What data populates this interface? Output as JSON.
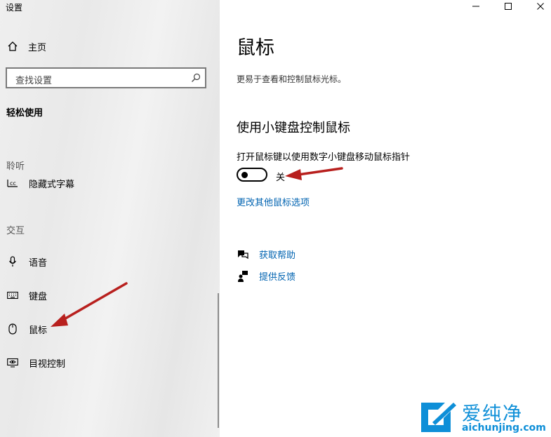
{
  "window": {
    "app_title": "设置",
    "controls": [
      "minimize-icon",
      "maximize-icon",
      "close-icon"
    ]
  },
  "sidebar": {
    "home_label": "主页",
    "search": {
      "placeholder": "查找设置",
      "icon": "search-icon"
    },
    "section_title": "轻松使用",
    "groups": [
      {
        "label": "聆听",
        "items": [
          {
            "label": "隐藏式字幕",
            "icon": "closed-captions-icon"
          }
        ]
      },
      {
        "label": "交互",
        "items": [
          {
            "label": "语音",
            "icon": "microphone-icon"
          },
          {
            "label": "键盘",
            "icon": "keyboard-icon"
          },
          {
            "label": "鼠标",
            "icon": "mouse-icon"
          },
          {
            "label": "目视控制",
            "icon": "eye-control-icon"
          }
        ]
      }
    ]
  },
  "main": {
    "title": "鼠标",
    "description": "更易于查看和控制鼠标光标。",
    "section_heading": "使用小键盘控制鼠标",
    "toggle": {
      "label": "打开鼠标键以使用数字小键盘移动鼠标指针",
      "state": "关",
      "on": false
    },
    "link_more_options": "更改其他鼠标选项",
    "help": {
      "get_help": "获取帮助",
      "feedback": "提供反馈"
    }
  },
  "watermark": {
    "text": "爱纯净",
    "url": "aichunjing.com"
  },
  "colors": {
    "link": "#0063b1",
    "annotation_arrow": "#b8201e",
    "watermark": "#0e8fd8"
  }
}
